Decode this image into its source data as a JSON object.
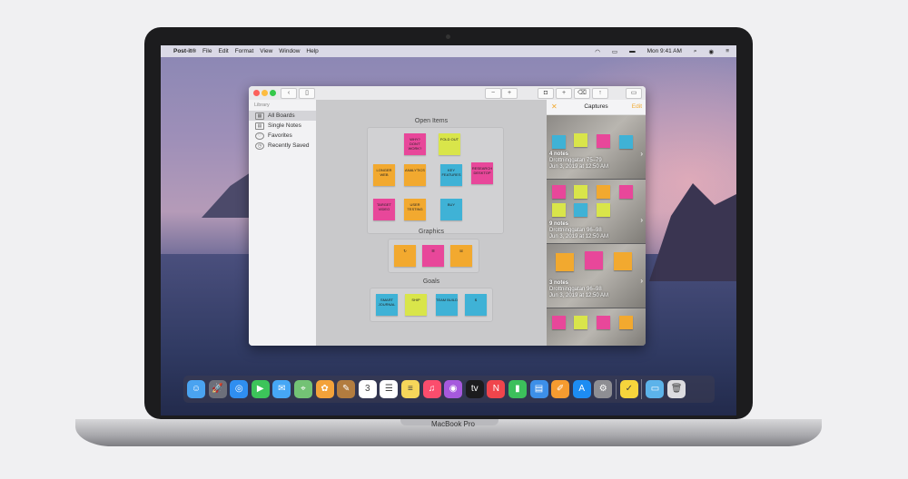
{
  "device": {
    "label": "MacBook Pro"
  },
  "menubar": {
    "items": [
      "Post-it®",
      "File",
      "Edit",
      "Format",
      "View",
      "Window",
      "Help"
    ],
    "clock": "Mon 9:41 AM"
  },
  "app": {
    "library_title": "Library",
    "sidebar": [
      {
        "label": "All Boards",
        "icon": "boards-icon"
      },
      {
        "label": "Single Notes",
        "icon": "notes-icon"
      },
      {
        "label": "Favorites",
        "icon": "heart-icon"
      },
      {
        "label": "Recently Saved",
        "icon": "clock-icon"
      }
    ],
    "sections": {
      "open_items": "Open Items",
      "graphics": "Graphics",
      "goals": "Goals"
    },
    "open_notes": [
      {
        "text": "WHY? DON'T WORK?",
        "color": "#e8479a"
      },
      {
        "text": "FOLD OUT",
        "color": "#d9e54a"
      },
      {
        "text": "LONGER WEB",
        "color": "#f2a92f"
      },
      {
        "text": "ANALYTICS",
        "color": "#f2a92f"
      },
      {
        "text": "KEY FEATURES",
        "color": "#3fb2d6"
      },
      {
        "text": "RESEARCH DESKTOP",
        "color": "#e8479a"
      },
      {
        "text": "TARGET VIDEO",
        "color": "#e8479a"
      },
      {
        "text": "USER TESTING",
        "color": "#f2a92f"
      },
      {
        "text": "BUY",
        "color": "#3fb2d6"
      }
    ],
    "graphic_notes": [
      {
        "color": "#f2a92f"
      },
      {
        "color": "#e8479a"
      },
      {
        "color": "#f2a92f"
      }
    ],
    "goal_notes": [
      {
        "text": "SMART JOURNAL",
        "color": "#3fb2d6"
      },
      {
        "text": "SHIP",
        "color": "#d9e54a"
      },
      {
        "text": "TEAM BUILD",
        "color": "#3fb2d6"
      },
      {
        "text": "$",
        "color": "#3fb2d6"
      }
    ],
    "captures_panel": {
      "title": "Captures",
      "edit": "Edit",
      "items": [
        {
          "count": "4 notes",
          "place": "Drottninggatan 75–79",
          "date": "Jun 3, 2019 at 12:50 AM"
        },
        {
          "count": "9 notes",
          "place": "Drottninggatan 96–98",
          "date": "Jun 3, 2019 at 12:50 AM"
        },
        {
          "count": "3 notes",
          "place": "Drottninggatan 96–98",
          "date": "Jun 3, 2019 at 12:50 AM"
        }
      ]
    }
  },
  "dock": {
    "apps": [
      {
        "name": "finder-icon",
        "color": "#4aa3f0",
        "glyph": "☺"
      },
      {
        "name": "launchpad-icon",
        "color": "#6d6f7a",
        "glyph": "🚀"
      },
      {
        "name": "safari-icon",
        "color": "#2f8ef0",
        "glyph": "◎"
      },
      {
        "name": "facetime-icon",
        "color": "#3cc45a",
        "glyph": "▶"
      },
      {
        "name": "messages-icon",
        "color": "#46a7f5",
        "glyph": "✉"
      },
      {
        "name": "maps-icon",
        "color": "#73c275",
        "glyph": "⌖"
      },
      {
        "name": "photos-icon",
        "color": "#f3a23a",
        "glyph": "✿"
      },
      {
        "name": "notes-app-icon",
        "color": "#b27c3f",
        "glyph": "✎"
      },
      {
        "name": "calendar-icon",
        "color": "#ffffff",
        "glyph": "3"
      },
      {
        "name": "reminders-icon",
        "color": "#ffffff",
        "glyph": "☰"
      },
      {
        "name": "notes-icon",
        "color": "#f6d65a",
        "glyph": "≡"
      },
      {
        "name": "music-icon",
        "color": "#fb4d6d",
        "glyph": "♫"
      },
      {
        "name": "podcasts-icon",
        "color": "#a659dd",
        "glyph": "◉"
      },
      {
        "name": "tv-icon",
        "color": "#1b1b1d",
        "glyph": "tv"
      },
      {
        "name": "news-icon",
        "color": "#f0454c",
        "glyph": "N"
      },
      {
        "name": "numbers-icon",
        "color": "#3cbf5b",
        "glyph": "▮"
      },
      {
        "name": "keynote-icon",
        "color": "#3d8fe8",
        "glyph": "▤"
      },
      {
        "name": "pages-icon",
        "color": "#f59b30",
        "glyph": "✐"
      },
      {
        "name": "appstore-icon",
        "color": "#1d8cf2",
        "glyph": "A"
      },
      {
        "name": "settings-icon",
        "color": "#8e8e93",
        "glyph": "⚙"
      },
      {
        "name": "postit-icon",
        "color": "#f6d53c",
        "glyph": "✓"
      },
      {
        "name": "downloads-folder-icon",
        "color": "#5cb3ea",
        "glyph": "▭"
      },
      {
        "name": "trash-icon",
        "color": "#dcdce0",
        "glyph": "🗑"
      }
    ]
  }
}
